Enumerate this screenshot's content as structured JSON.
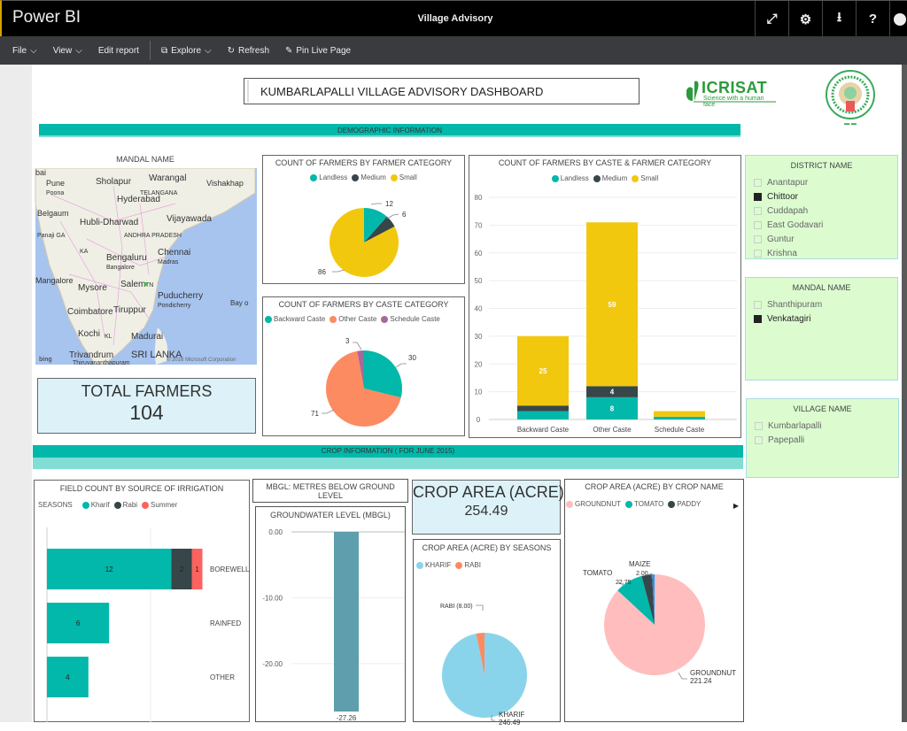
{
  "app": {
    "name": "Power BI",
    "report_title": "Village Advisory",
    "title_icons": [
      "expand-icon",
      "gear-icon",
      "download-icon",
      "help-icon",
      "user-icon"
    ]
  },
  "menu": {
    "file": "File",
    "view": "View",
    "edit_report": "Edit report",
    "explore": "Explore",
    "refresh": "Refresh",
    "pin_live_page": "Pin Live Page"
  },
  "dashboard": {
    "title": "KUMBARLAPALLI VILLAGE ADVISORY DASHBOARD",
    "logo_icrisat": "ICRISAT",
    "logo_icrisat_tagline": "Science with a human face",
    "demographic_banner": "DEMOGRAPHIC INFORMATION",
    "crop_banner": "CROP INFORMATION ( FOR JUNE  2015)",
    "mbgl_note": "MBGL: METRES BELOW GROUND LEVEL"
  },
  "map": {
    "title": "MANDAL NAME",
    "labels": [
      "bai",
      "Pune",
      "Poona",
      "Sholapur",
      "Warangal",
      "Vishakhap",
      "TELANGANA",
      "Hyderabad",
      "Belgaum",
      "Hubli-Dharwad",
      "Vijayawada",
      "Panaji GA",
      "ANDHRA PRADESH",
      "KA",
      "Chennai",
      "Madras",
      "Bengaluru",
      "Bangalore",
      "Mangalore",
      "Mysore",
      "Salem",
      "TN",
      "Puducherry",
      "Pondicherry",
      "Bay o",
      "Coimbatore",
      "Tiruppur",
      "Kochi",
      "KL",
      "Madurai",
      "Trivandrum",
      "Thiruvananthapuram",
      "SRI LANKA"
    ],
    "attribution": "© 2016 Microsoft Corporation",
    "bing": "bing"
  },
  "cards": {
    "total_farmers_label": "TOTAL FARMERS",
    "total_farmers_value": "104",
    "crop_area_label": "CROP AREA (ACRE)",
    "crop_area_value": "254.49"
  },
  "slicers": {
    "district": {
      "title": "DISTRICT NAME",
      "items": [
        {
          "label": "Anantapur",
          "selected": false
        },
        {
          "label": "Chittoor",
          "selected": true
        },
        {
          "label": "Cuddapah",
          "selected": false
        },
        {
          "label": "East Godavari",
          "selected": false
        },
        {
          "label": "Guntur",
          "selected": false
        },
        {
          "label": "Krishna",
          "selected": false
        }
      ]
    },
    "mandal": {
      "title": "MANDAL NAME",
      "items": [
        {
          "label": "Shanthipuram",
          "selected": false
        },
        {
          "label": "Venkatagiri",
          "selected": true
        }
      ]
    },
    "village": {
      "title": "VILLAGE NAME",
      "items": [
        {
          "label": "Kumbarlapalli",
          "selected": false
        },
        {
          "label": "Papepalli",
          "selected": false
        }
      ]
    }
  },
  "colors": {
    "teal": "#01b8aa",
    "dark": "#374649",
    "yellow": "#f2c80f",
    "salmon": "#fd8b62",
    "purple": "#a66999",
    "red": "#fd625e",
    "light_blue": "#8ad4eb",
    "pink": "#ffbdbd",
    "blue": "#2196f3",
    "steel": "#5f9eac",
    "slicer_bg": "#dcfcd0",
    "card_bg": "#dcf2f8"
  },
  "chart_data": [
    {
      "id": "farmer_category",
      "type": "pie",
      "title": "COUNT OF FARMERS BY FARMER CATEGORY",
      "categories": [
        "Landless",
        "Medium",
        "Small"
      ],
      "values": [
        12,
        6,
        86
      ],
      "legend": "top-center"
    },
    {
      "id": "caste_category",
      "type": "pie",
      "title": "COUNT OF FARMERS BY CASTE CATEGORY",
      "categories": [
        "Backward Caste",
        "Other Caste",
        "Schedule Caste"
      ],
      "values": [
        30,
        71,
        3
      ],
      "legend": "top-center"
    },
    {
      "id": "caste_farmer",
      "type": "bar",
      "stacked": true,
      "title": "COUNT OF FARMERS BY CASTE & FARMER CATEGORY",
      "categories": [
        "Backward Caste",
        "Other Caste",
        "Schedule Caste"
      ],
      "series": [
        {
          "name": "Landless",
          "values": [
            3,
            8,
            1
          ]
        },
        {
          "name": "Medium",
          "values": [
            2,
            4,
            0
          ]
        },
        {
          "name": "Small",
          "values": [
            25,
            59,
            2
          ]
        }
      ],
      "data_labels": [
        [
          "",
          "8",
          ""
        ],
        [
          "",
          "4",
          ""
        ],
        [
          "25",
          "59",
          ""
        ]
      ],
      "ylim": [
        0,
        80
      ],
      "yticks": [
        0,
        10,
        20,
        30,
        40,
        50,
        60,
        70,
        80
      ],
      "grid": true,
      "legend": "top-center"
    },
    {
      "id": "irrigation",
      "type": "bar",
      "orientation": "horizontal",
      "stacked": true,
      "title": "FIELD COUNT BY SOURCE OF IRRIGATION",
      "legend_title": "SEASONS",
      "categories": [
        "BOREWELL",
        "RAINFED",
        "OTHER"
      ],
      "series": [
        {
          "name": "Kharif",
          "values": [
            12,
            6,
            4
          ]
        },
        {
          "name": "Rabi",
          "values": [
            2,
            0,
            0
          ]
        },
        {
          "name": "Summer",
          "values": [
            1,
            0,
            0
          ]
        }
      ],
      "xlim": [
        0,
        20
      ],
      "legend": "top-left"
    },
    {
      "id": "groundwater",
      "type": "bar",
      "title": "GROUNDWATER LEVEL (MBGL)",
      "categories": [
        ""
      ],
      "values": [
        -27.26
      ],
      "data_labels": [
        "-27.26"
      ],
      "ylim": [
        -27.26,
        0
      ],
      "yticks": [
        "0.00",
        "-10.00",
        "-20.00"
      ]
    },
    {
      "id": "crop_seasons",
      "type": "pie",
      "title": "CROP AREA (ACRE) BY SEASONS",
      "categories": [
        "KHARIF",
        "RABI"
      ],
      "values": [
        246.49,
        8.0
      ],
      "data_labels": [
        "KHARIF 246.49",
        "RABI (8.00)"
      ],
      "legend": "top-left"
    },
    {
      "id": "crop_name",
      "type": "pie",
      "title": "CROP AREA (ACRE) BY CROP NAME",
      "categories": [
        "GROUNDNUT",
        "TOMATO",
        "PADDY",
        "MAIZE"
      ],
      "values": [
        221.24,
        22.75,
        8.5,
        2.0
      ],
      "data_labels": [
        "GROUNDNUT 221.24",
        "TOMATO 22.75",
        "",
        "MAIZE 2.00"
      ],
      "legend": "top-left"
    }
  ]
}
